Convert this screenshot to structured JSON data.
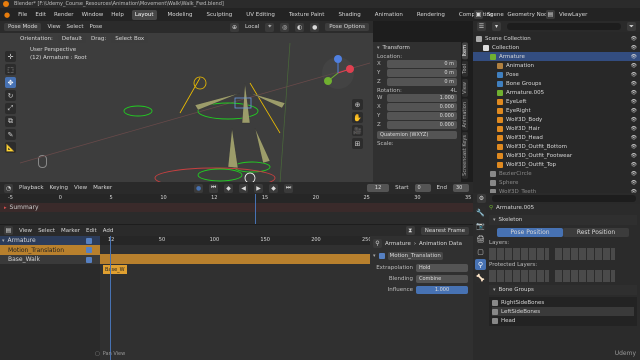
{
  "window": {
    "title": "Blender* [F:\\Udemy_Course_Resources\\Animation\\Movement\\Walk\\Walk_Fwd.blend]"
  },
  "menu": {
    "items": [
      "File",
      "Edit",
      "Render",
      "Window",
      "Help"
    ],
    "workspaces": [
      "Layout",
      "Modeling",
      "Sculpting",
      "UV Editing",
      "Texture Paint",
      "Shading",
      "Animation",
      "Rendering",
      "Compositing",
      "Geometry Nodes"
    ],
    "active_workspace": "Layout",
    "scene": "Scene",
    "view_layer": "ViewLayer"
  },
  "viewport": {
    "mode": "Pose Mode",
    "menus": [
      "View",
      "Select",
      "Pose"
    ],
    "orientation_label": "Orientation:",
    "orientation_value": "Default",
    "drag_label": "Drag:",
    "drag_value": "Select Box",
    "pivot": "Local",
    "pose_options": "Pose Options",
    "info_line1": "User Perspective",
    "info_line2": "(12) Armature : Root",
    "tools": [
      "cursor",
      "select",
      "move",
      "rotate",
      "scale",
      "transform",
      "annotate",
      "measure"
    ]
  },
  "transform_panel": {
    "title": "Transform",
    "location_label": "Location:",
    "location": [
      {
        "axis": "X",
        "value": "0 m"
      },
      {
        "axis": "Y",
        "value": "0 m"
      },
      {
        "axis": "Z",
        "value": "0 m"
      }
    ],
    "rotation_label": "Rotation:",
    "rotation_mode_tag": "4L",
    "rotation": [
      {
        "axis": "W",
        "value": "1.000"
      },
      {
        "axis": "X",
        "value": "0.000"
      },
      {
        "axis": "Y",
        "value": "0.000"
      },
      {
        "axis": "Z",
        "value": "0.000"
      }
    ],
    "rotation_mode": "Quaternion (WXYZ)",
    "scale_label": "Scale:",
    "tabs": [
      "Item",
      "Tool",
      "View",
      "Animation",
      "Screencast Keys"
    ]
  },
  "outliner": {
    "items": [
      {
        "label": "Scene Collection",
        "indent": 0
      },
      {
        "label": "Collection",
        "indent": 1
      },
      {
        "label": "Armature",
        "indent": 2,
        "selected": true
      },
      {
        "label": "Animation",
        "indent": 3
      },
      {
        "label": "Pose",
        "indent": 3
      },
      {
        "label": "Bone Groups",
        "indent": 3
      },
      {
        "label": "Armature.005",
        "indent": 3
      },
      {
        "label": "EyeLeft",
        "indent": 3
      },
      {
        "label": "EyeRight",
        "indent": 3
      },
      {
        "label": "Wolf3D_Body",
        "indent": 3
      },
      {
        "label": "Wolf3D_Hair",
        "indent": 3
      },
      {
        "label": "Wolf3D_Head",
        "indent": 3
      },
      {
        "label": "Wolf3D_Outfit_Bottom",
        "indent": 3
      },
      {
        "label": "Wolf3D_Outfit_Footwear",
        "indent": 3
      },
      {
        "label": "Wolf3D_Outfit_Top",
        "indent": 3
      },
      {
        "label": "BezierCircle",
        "indent": 2
      },
      {
        "label": "Sphere",
        "indent": 2
      },
      {
        "label": "Wolf3D_Teeth",
        "indent": 2
      }
    ]
  },
  "timeline": {
    "menus": [
      "Playback",
      "Keying",
      "View",
      "Marker"
    ],
    "current_frame": "12",
    "start_label": "Start",
    "start": "0",
    "end_label": "End",
    "end": "30",
    "ticks": [
      "-5",
      "0",
      "5",
      "10",
      "12",
      "15",
      "20",
      "25",
      "30",
      "35"
    ],
    "summary": "Summary"
  },
  "nla": {
    "menus": [
      "View",
      "Select",
      "Marker",
      "Edit",
      "Add"
    ],
    "snap": "Nearest Frame",
    "current_frame": "12",
    "ticks": [
      "12",
      "50",
      "100",
      "150",
      "200",
      "250"
    ],
    "tracks": [
      {
        "label": "Armature",
        "kind": "object"
      },
      {
        "label": "Motion_Translation",
        "kind": "action"
      },
      {
        "label": "Base_Walk",
        "kind": "track"
      }
    ],
    "strip_label": "Base_W",
    "status": "Pan View"
  },
  "strip_panel": {
    "breadcrumb1": "Armature",
    "breadcrumb2": "Animation Data",
    "strip_name": "Motion_Translation",
    "extrapolation_label": "Extrapolation",
    "extrapolation": "Hold",
    "blending_label": "Blending",
    "blending": "Combine",
    "influence_label": "Influence",
    "influence": "1.000"
  },
  "properties": {
    "object_name": "Armature.005",
    "skeleton_title": "Skeleton",
    "pose_position": "Pose Position",
    "rest_position": "Rest Position",
    "layers_label": "Layers:",
    "protected_label": "Protected Layers:",
    "bone_groups_title": "Bone Groups",
    "bone_groups": [
      "RightSideBones",
      "LeftSideBones",
      "Head"
    ],
    "watermark": "Udemy"
  },
  "colors": {
    "accent": "#4772b3",
    "nla_action": "#b8802d",
    "nla_strip": "#e0a030",
    "selected": "#334d80"
  }
}
